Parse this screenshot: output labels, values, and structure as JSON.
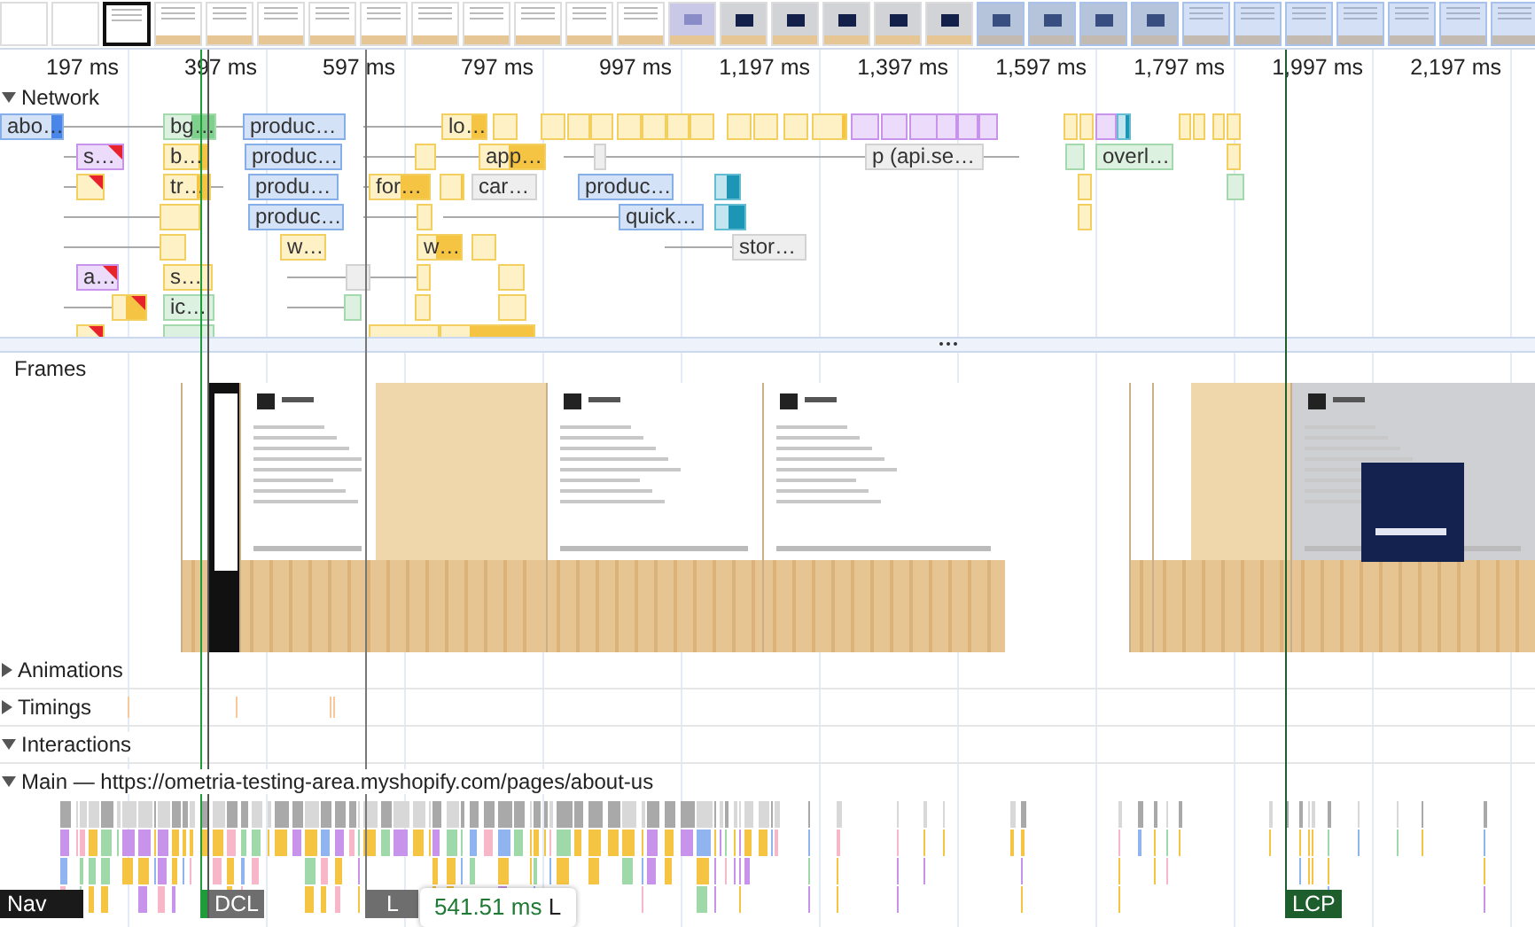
{
  "filmstrip": [
    {
      "kind": "blank",
      "selected": false
    },
    {
      "kind": "blank",
      "selected": false
    },
    {
      "kind": "dark",
      "selected": false
    },
    {
      "kind": "page",
      "selected": false
    },
    {
      "kind": "page",
      "selected": false
    },
    {
      "kind": "page",
      "selected": false
    },
    {
      "kind": "page",
      "selected": false
    },
    {
      "kind": "page",
      "selected": false
    },
    {
      "kind": "page",
      "selected": false
    },
    {
      "kind": "page",
      "selected": false
    },
    {
      "kind": "page",
      "selected": false
    },
    {
      "kind": "page",
      "selected": false
    },
    {
      "kind": "page",
      "selected": false
    },
    {
      "kind": "modal-light",
      "selected": false
    },
    {
      "kind": "modal",
      "selected": false
    },
    {
      "kind": "modal",
      "selected": false
    },
    {
      "kind": "modal",
      "selected": false
    },
    {
      "kind": "modal",
      "selected": false
    },
    {
      "kind": "modal",
      "selected": false
    },
    {
      "kind": "modal",
      "selected": true
    },
    {
      "kind": "modal",
      "selected": true
    },
    {
      "kind": "modal",
      "selected": true
    },
    {
      "kind": "modal",
      "selected": true
    },
    {
      "kind": "page",
      "selected": true
    },
    {
      "kind": "page",
      "selected": true
    },
    {
      "kind": "page",
      "selected": true
    },
    {
      "kind": "page",
      "selected": true
    },
    {
      "kind": "page",
      "selected": true
    },
    {
      "kind": "page",
      "selected": true
    },
    {
      "kind": "page",
      "selected": true
    }
  ],
  "ruler": {
    "labels": [
      "197 ms",
      "397 ms",
      "597 ms",
      "797 ms",
      "997 ms",
      "1,197 ms",
      "1,397 ms",
      "1,597 ms",
      "1,797 ms",
      "1,997 ms",
      "2,197 ms"
    ]
  },
  "network": {
    "title": "Network",
    "expanded": true,
    "rows": [
      {
        "requests": [
          {
            "kind": "doc",
            "label": "abo…",
            "blocking": false
          },
          {
            "kind": "image",
            "label": "bg…",
            "blocking": false
          },
          {
            "kind": "doc",
            "label": "produc…",
            "blocking": false
          },
          {
            "kind": "script",
            "label": "lo…",
            "blocking": false
          },
          {
            "kind": "script",
            "blocking": false
          },
          {
            "kind": "script",
            "blocking": false
          },
          {
            "kind": "script",
            "blocking": false
          },
          {
            "kind": "script",
            "blocking": false
          },
          {
            "kind": "script",
            "blocking": false
          },
          {
            "kind": "script",
            "blocking": false
          },
          {
            "kind": "script",
            "blocking": false
          },
          {
            "kind": "script",
            "blocking": false
          },
          {
            "kind": "script",
            "blocking": false
          },
          {
            "kind": "script",
            "blocking": false
          },
          {
            "kind": "script",
            "blocking": false
          },
          {
            "kind": "script",
            "blocking": false
          },
          {
            "kind": "css",
            "blocking": false
          },
          {
            "kind": "css",
            "blocking": false
          },
          {
            "kind": "css",
            "blocking": false
          },
          {
            "kind": "css",
            "blocking": false
          },
          {
            "kind": "css",
            "blocking": false
          },
          {
            "kind": "css",
            "blocking": false
          },
          {
            "kind": "script",
            "blocking": false
          },
          {
            "kind": "script",
            "blocking": false
          },
          {
            "kind": "css",
            "blocking": false
          },
          {
            "kind": "media",
            "blocking": false
          },
          {
            "kind": "script",
            "blocking": false
          },
          {
            "kind": "script",
            "blocking": false
          },
          {
            "kind": "script",
            "blocking": false
          },
          {
            "kind": "script",
            "blocking": false
          }
        ]
      },
      {
        "requests": [
          {
            "kind": "css",
            "label": "s…",
            "blocking": true
          },
          {
            "kind": "script",
            "label": "b…",
            "blocking": false
          },
          {
            "kind": "doc",
            "label": "produc…",
            "blocking": false
          },
          {
            "kind": "script",
            "blocking": false
          },
          {
            "kind": "script",
            "label": "app…",
            "blocking": false
          },
          {
            "kind": "other",
            "blocking": false
          },
          {
            "kind": "other",
            "label": "p (api.se…",
            "blocking": false
          },
          {
            "kind": "image",
            "blocking": false
          },
          {
            "kind": "image",
            "label": "overl…",
            "blocking": false
          },
          {
            "kind": "script",
            "blocking": false
          }
        ]
      },
      {
        "requests": [
          {
            "kind": "script",
            "blocking": true
          },
          {
            "kind": "script",
            "label": "tr…",
            "blocking": false
          },
          {
            "kind": "doc",
            "label": "produ…",
            "blocking": false
          },
          {
            "kind": "script",
            "label": "for…",
            "blocking": false
          },
          {
            "kind": "script",
            "blocking": false
          },
          {
            "kind": "other",
            "label": "car…",
            "blocking": false
          },
          {
            "kind": "doc",
            "label": "produc…",
            "blocking": false
          },
          {
            "kind": "media",
            "blocking": false
          },
          {
            "kind": "script",
            "blocking": false
          },
          {
            "kind": "image",
            "blocking": false
          }
        ]
      },
      {
        "requests": [
          {
            "kind": "script",
            "blocking": false
          },
          {
            "kind": "doc",
            "label": "produc…",
            "blocking": false
          },
          {
            "kind": "script",
            "blocking": false
          },
          {
            "kind": "doc",
            "label": "quick…",
            "blocking": false
          },
          {
            "kind": "media",
            "blocking": false
          },
          {
            "kind": "script",
            "blocking": false
          }
        ]
      },
      {
        "requests": [
          {
            "kind": "script",
            "blocking": false
          },
          {
            "kind": "script",
            "label": "w…",
            "blocking": false
          },
          {
            "kind": "script",
            "label": "w…",
            "blocking": false
          },
          {
            "kind": "script",
            "blocking": false
          },
          {
            "kind": "other",
            "label": "stor…",
            "blocking": false
          }
        ]
      },
      {
        "requests": [
          {
            "kind": "css",
            "label": "a…",
            "blocking": true
          },
          {
            "kind": "script",
            "label": "s…",
            "blocking": false
          },
          {
            "kind": "other",
            "blocking": false
          },
          {
            "kind": "script",
            "blocking": false
          },
          {
            "kind": "script",
            "blocking": false
          }
        ]
      },
      {
        "requests": [
          {
            "kind": "script",
            "blocking": true
          },
          {
            "kind": "image",
            "label": "ic…",
            "blocking": false
          },
          {
            "kind": "image",
            "blocking": false
          },
          {
            "kind": "script",
            "blocking": false
          },
          {
            "kind": "script",
            "blocking": false
          }
        ]
      },
      {
        "requests": [
          {
            "kind": "script",
            "blocking": true
          },
          {
            "kind": "image",
            "blocking": false
          },
          {
            "kind": "script",
            "blocking": false
          },
          {
            "kind": "script",
            "blocking": false
          }
        ]
      }
    ]
  },
  "frames": {
    "title": "Frames"
  },
  "tracks": [
    {
      "title": "Animations",
      "expanded": false
    },
    {
      "title": "Timings",
      "expanded": false
    },
    {
      "title": "Interactions",
      "expanded": true
    }
  ],
  "main": {
    "title": "Main — https://ometria-testing-area.myshopify.com/pages/about-us",
    "expanded": true
  },
  "markers": [
    {
      "kind": "nav",
      "label": "Nav"
    },
    {
      "kind": "dcl",
      "label": "DCL"
    },
    {
      "kind": "load",
      "label": "L"
    },
    {
      "kind": "lcp",
      "label": "LCP"
    }
  ],
  "tooltip": {
    "time": "541.51 ms",
    "label": "L"
  }
}
